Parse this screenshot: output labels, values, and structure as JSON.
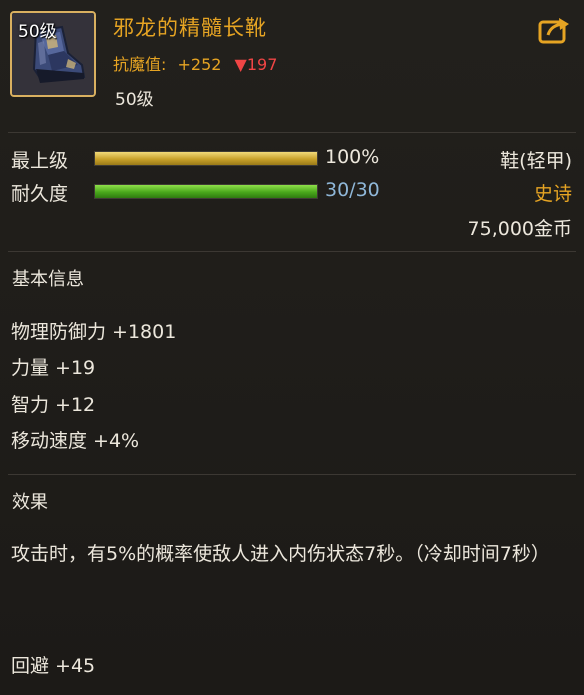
{
  "item": {
    "icon_level": "50级",
    "name": "邪龙的精髓长靴",
    "stat_label": "抗魔值:",
    "stat_value": "+252",
    "stat_diff_arrow": "▼",
    "stat_diff": "197",
    "required_level": "50级",
    "icon_name": "armored-boot-icon"
  },
  "bars": {
    "max_level": {
      "label": "最上级",
      "value_text": "100%",
      "fraction": 1.0,
      "color": "#e0c040"
    },
    "durability": {
      "label": "耐久度",
      "value_text": "30/30",
      "fraction": 1.0,
      "color": "#6cc22c",
      "value_color": "#8fb7d8"
    }
  },
  "item_type": "鞋(轻甲)",
  "rarity": {
    "label": "史诗",
    "color": "#e6a423"
  },
  "price": "75,000金币",
  "basic_info": {
    "title": "基本信息",
    "attributes": [
      "物理防御力 +1801",
      "力量 +19",
      "智力 +12",
      "移动速度 +4%"
    ]
  },
  "effect": {
    "title": "效果",
    "description": "攻击时，有5%的概率使敌人进入内伤状态7秒。（冷却时间7秒）",
    "bonus": "回避 +45"
  }
}
